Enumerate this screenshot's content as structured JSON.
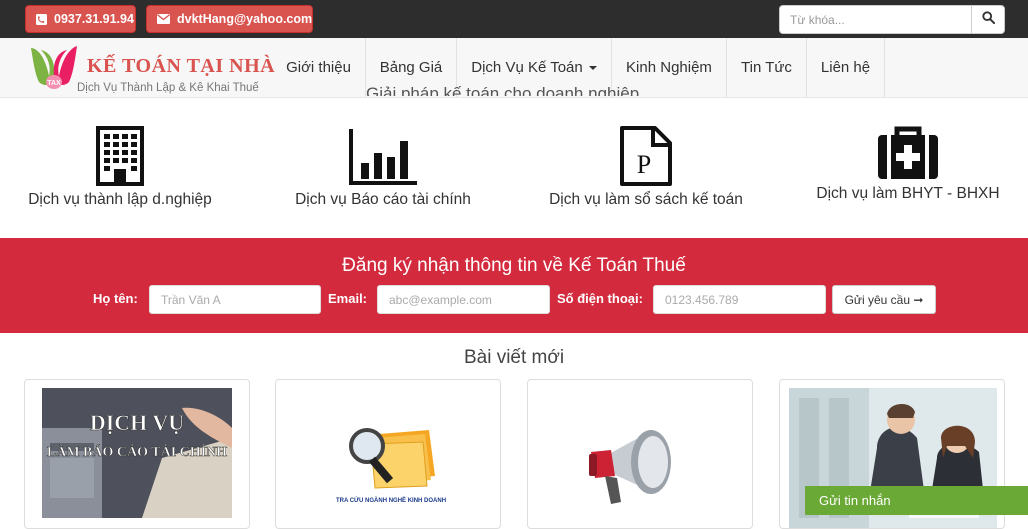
{
  "topbar": {
    "phone": "0937.31.91.94",
    "email": "dvktHang@yahoo.com",
    "search_placeholder": "Từ khóa..."
  },
  "logo": {
    "badge": "TAX",
    "name": "KẾ TOÁN TẠI NHÀ",
    "tagline": "Dịch Vụ Thành Lập & Kê Khai Thuế"
  },
  "nav": [
    {
      "label": "Giới thiệu"
    },
    {
      "label": "Bảng Giá"
    },
    {
      "label": "Dịch Vụ Kế Toán"
    },
    {
      "label": "Kinh Nghiệm"
    },
    {
      "label": "Tin Tức"
    },
    {
      "label": "Liên hệ"
    }
  ],
  "services_heading_partial": "Giải pháp kế toán cho doanh nghiệp",
  "services": [
    {
      "label": "Dịch vụ thành lập d.nghiệp",
      "icon": "building-icon"
    },
    {
      "label": "Dịch vụ Báo cáo tài chính",
      "icon": "bar-chart-icon"
    },
    {
      "label": "Dịch vụ làm sổ sách kế toán",
      "icon": "document-p-icon"
    },
    {
      "label": "Dịch vụ làm BHYT - BHXH",
      "icon": "medkit-icon"
    }
  ],
  "register": {
    "title": "Đăng ký nhận thông tin về Kế Toán Thuế",
    "name_label": "Họ tên:",
    "name_placeholder": "Trần Văn A",
    "email_label": "Email:",
    "email_placeholder": "abc@example.com",
    "phone_label": "Số điện thoại:",
    "phone_placeholder": "0123.456.789",
    "submit": "Gửi yêu cầu ➞"
  },
  "posts": {
    "title": "Bài viết mới",
    "card1_line1": "DỊCH VỤ",
    "card1_line2": "LÀM BÁO CÁO TÀI CHÍNH",
    "card2_caption": "TRA CỨU NGÀNH NGHỀ KINH DOANH"
  },
  "chat": "Gửi tin nhắn",
  "colors": {
    "accent_red": "#d42a3e",
    "topbar": "#2d2d2d",
    "chat_green": "#6aa936"
  }
}
